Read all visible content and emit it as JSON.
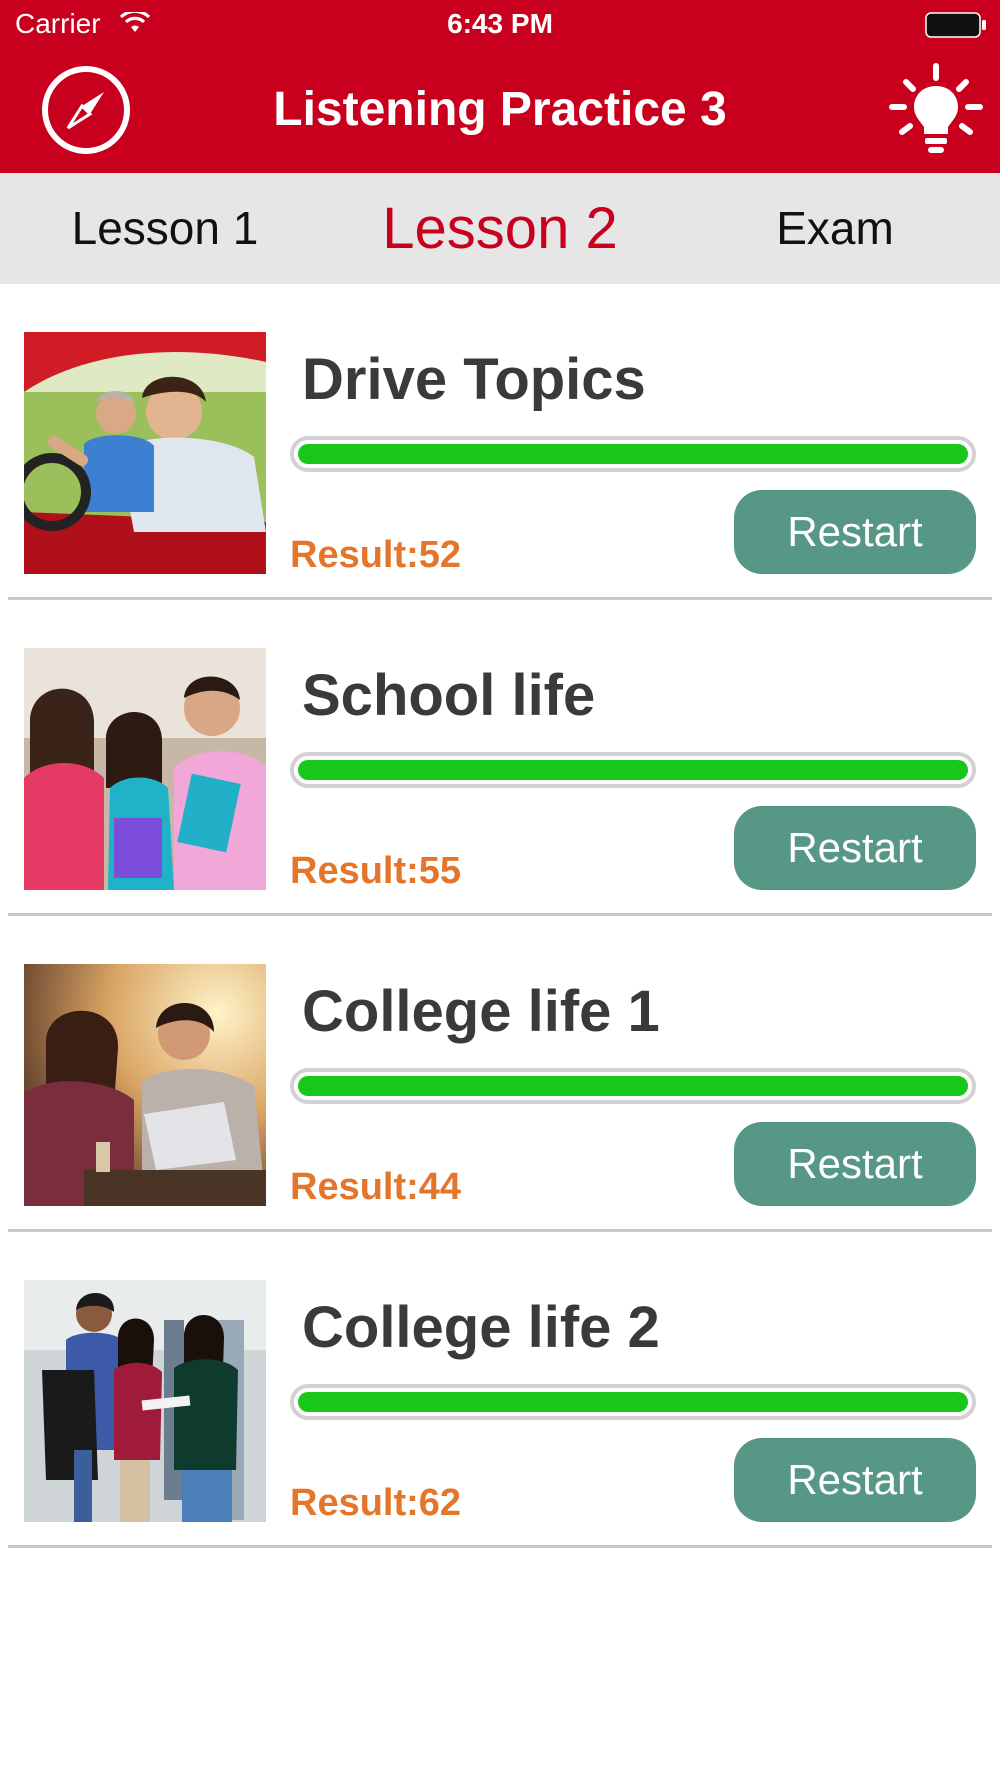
{
  "status_bar": {
    "carrier": "Carrier",
    "time": "6:43 PM",
    "wifi_icon": "wifi-icon",
    "battery_icon": "battery-icon"
  },
  "nav": {
    "title": "Listening Practice 3",
    "left_icon": "compass-icon",
    "right_icon": "lightbulb-icon",
    "color": "#c8001e"
  },
  "tabs": [
    {
      "label": "Lesson 1",
      "selected": false
    },
    {
      "label": "Lesson 2",
      "selected": true
    },
    {
      "label": "Exam",
      "selected": false
    }
  ],
  "colors": {
    "accent": "#c8001e",
    "progress": "#19c71a",
    "result_text": "#e4762c",
    "button": "#579786"
  },
  "lessons": [
    {
      "title": "Drive Topics",
      "progress": 1.0,
      "result": "Result:52",
      "button": "Restart",
      "thumbnail": "driving-photo"
    },
    {
      "title": "School life",
      "progress": 1.0,
      "result": "Result:55",
      "button": "Restart",
      "thumbnail": "students-photo"
    },
    {
      "title": "College life 1",
      "progress": 1.0,
      "result": "Result:44",
      "button": "Restart",
      "thumbnail": "cafe-laptop-photo"
    },
    {
      "title": "College life 2",
      "progress": 1.0,
      "result": "Result:62",
      "button": "Restart",
      "thumbnail": "campus-group-photo"
    }
  ]
}
